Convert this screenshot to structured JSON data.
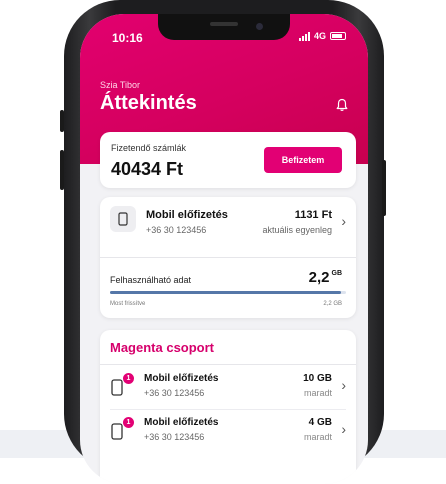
{
  "status_bar": {
    "time": "10:16",
    "network": "4G"
  },
  "header": {
    "greeting": "Szia Tibor",
    "title": "Áttekintés"
  },
  "bills": {
    "label": "Fizetendő számlák",
    "amount": "40434 Ft",
    "pay_button": "Befizetem"
  },
  "subscription": {
    "name": "Mobil előfizetés",
    "number": "+36 30 123456",
    "amount": "1131 Ft",
    "balance_label": "aktuális egyenleg",
    "data_label": "Felhasználható adat",
    "data_value": "2,2",
    "data_unit": "GB",
    "data_progress": 0.98,
    "updated": "Most frissítve",
    "updated_value": "2,2 GB"
  },
  "group": {
    "title": "Magenta csoport",
    "items": [
      {
        "badge": "1",
        "name": "Mobil előfizetés",
        "number": "+36 30 123456",
        "amount": "10 GB",
        "remaining": "maradt"
      },
      {
        "badge": "1",
        "name": "Mobil előfizetés",
        "number": "+36 30 123456",
        "amount": "4 GB",
        "remaining": "maradt"
      }
    ]
  },
  "colors": {
    "brand": "#e20074",
    "progress": "#5577a8"
  },
  "icons": [
    "bell-icon",
    "phone-icon",
    "chevron-right-icon",
    "signal-icon",
    "battery-icon"
  ]
}
